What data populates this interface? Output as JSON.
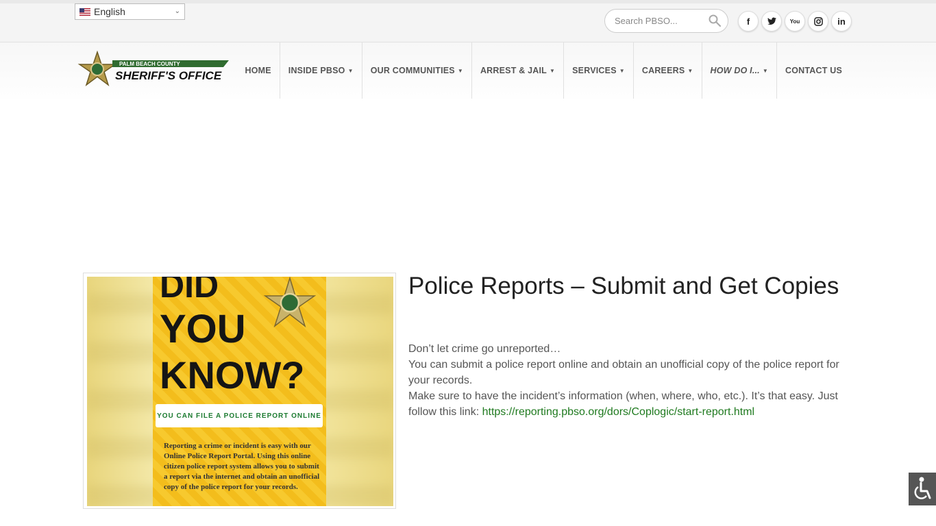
{
  "topbar": {
    "language": "English",
    "search_placeholder": "Search PBSO...",
    "social": [
      {
        "name": "facebook-icon",
        "glyph": "f"
      },
      {
        "name": "twitter-icon",
        "glyph": "t"
      },
      {
        "name": "youtube-icon",
        "glyph": "You"
      },
      {
        "name": "instagram-icon",
        "glyph": "◎"
      },
      {
        "name": "linkedin-icon",
        "glyph": "in"
      }
    ]
  },
  "logo": {
    "line1": "PALM BEACH COUNTY",
    "line2": "SHERIFF'S OFFICE"
  },
  "nav": {
    "items": [
      {
        "label": "HOME",
        "dropdown": false
      },
      {
        "label": "INSIDE PBSO",
        "dropdown": true
      },
      {
        "label": "OUR COMMUNITIES",
        "dropdown": true
      },
      {
        "label": "ARREST & JAIL",
        "dropdown": true
      },
      {
        "label": "SERVICES",
        "dropdown": true
      },
      {
        "label": "CAREERS",
        "dropdown": true
      },
      {
        "label": "HOW DO I...",
        "dropdown": true
      },
      {
        "label": "CONTACT US",
        "dropdown": false
      }
    ]
  },
  "poster": {
    "line1": "DID",
    "line2": "YOU",
    "line3": "KNOW?",
    "banner": "YOU CAN FILE A POLICE REPORT ONLINE",
    "desc": "Reporting a crime or incident is easy with our Online Police Report Portal. Using this online citizen police report system allows you to submit a report via the internet and obtain an unofficial copy of the police report for your records."
  },
  "article": {
    "title": "Police Reports – Submit and Get Copies",
    "p1": "Don’t let crime go unreported…",
    "p2": "You can submit a police report online and obtain an unofficial copy of the police report for your records.",
    "p3": "Make sure to have the incident’s information (when, where, who, etc.). It’s that easy. Just follow this link: ",
    "link": "https://reporting.pbso.org/dors/Coplogic/start-report.html"
  },
  "colors": {
    "accent_green": "#1f7a1f",
    "poster_yellow": "#f7c92e"
  }
}
